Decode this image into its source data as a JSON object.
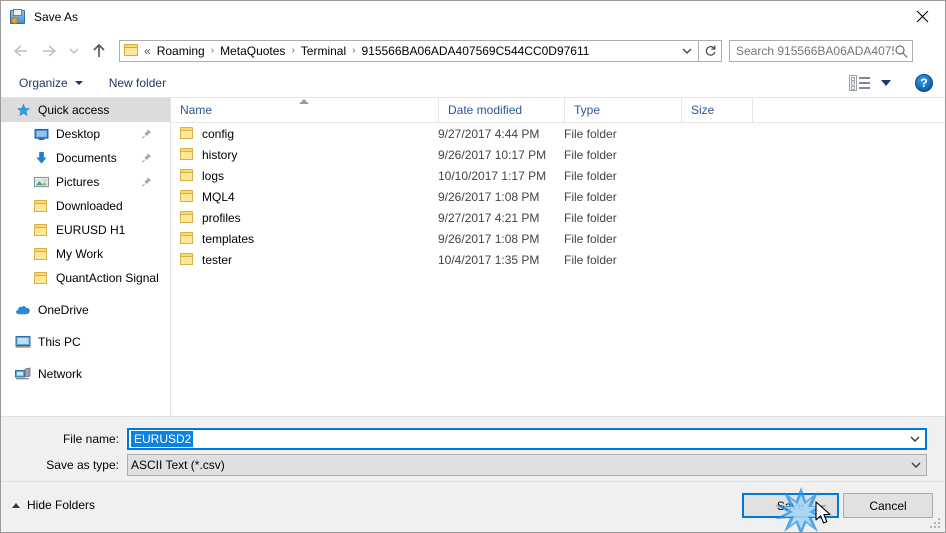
{
  "window": {
    "title": "Save As",
    "icon": "save-as-app-icon",
    "close_label": "✕"
  },
  "nav": {
    "back_label": "←",
    "forward_label": "→",
    "recent_label": "∨",
    "up_label": "↑",
    "overflow": "«",
    "breadcrumbs": [
      {
        "label": "Roaming"
      },
      {
        "label": "MetaQuotes"
      },
      {
        "label": "Terminal"
      },
      {
        "label": "915566BA06ADA407569C544CC0D97611"
      }
    ],
    "separator": "›",
    "dropdown_label": "∨",
    "refresh_label": "↻"
  },
  "search": {
    "placeholder": "Search 915566BA06ADA40756...",
    "icon": "search-icon"
  },
  "toolbar": {
    "organize_label": "Organize",
    "new_folder_label": "New folder",
    "view_icon": "view-layout-icon",
    "view_dropdown": "chevron-down-icon",
    "help_label": "?"
  },
  "sidebar": {
    "items": [
      {
        "label": "Quick access",
        "icon": "star-icon",
        "level": 0,
        "selected": true,
        "pinned": false
      },
      {
        "label": "Desktop",
        "icon": "monitor-icon",
        "level": 1,
        "selected": false,
        "pinned": true
      },
      {
        "label": "Documents",
        "icon": "download-arrow-icon",
        "level": 1,
        "selected": false,
        "pinned": true
      },
      {
        "label": "Pictures",
        "icon": "picture-icon",
        "level": 1,
        "selected": false,
        "pinned": true
      },
      {
        "label": "Downloaded",
        "icon": "folder-icon",
        "level": 1,
        "selected": false,
        "pinned": false
      },
      {
        "label": "EURUSD H1",
        "icon": "folder-icon",
        "level": 1,
        "selected": false,
        "pinned": false
      },
      {
        "label": "My Work",
        "icon": "folder-icon",
        "level": 1,
        "selected": false,
        "pinned": false
      },
      {
        "label": "QuantAction Signal",
        "icon": "folder-icon",
        "level": 1,
        "selected": false,
        "pinned": false
      },
      {
        "label": "OneDrive",
        "icon": "cloud-icon",
        "level": 0,
        "selected": false,
        "pinned": false
      },
      {
        "label": "This PC",
        "icon": "computer-icon",
        "level": 0,
        "selected": false,
        "pinned": false
      },
      {
        "label": "Network",
        "icon": "network-icon",
        "level": 0,
        "selected": false,
        "pinned": false
      }
    ]
  },
  "filelist": {
    "columns": [
      "Name",
      "Date modified",
      "Type",
      "Size"
    ],
    "sort_column": "Name",
    "sort_direction": "ascending",
    "rows": [
      {
        "name": "config",
        "date": "9/27/2017 4:44 PM",
        "type": "File folder",
        "size": ""
      },
      {
        "name": "history",
        "date": "9/26/2017 10:17 PM",
        "type": "File folder",
        "size": ""
      },
      {
        "name": "logs",
        "date": "10/10/2017 1:17 PM",
        "type": "File folder",
        "size": ""
      },
      {
        "name": "MQL4",
        "date": "9/26/2017 1:08 PM",
        "type": "File folder",
        "size": ""
      },
      {
        "name": "profiles",
        "date": "9/27/2017 4:21 PM",
        "type": "File folder",
        "size": ""
      },
      {
        "name": "templates",
        "date": "9/26/2017 1:08 PM",
        "type": "File folder",
        "size": ""
      },
      {
        "name": "tester",
        "date": "10/4/2017 1:35 PM",
        "type": "File folder",
        "size": ""
      }
    ]
  },
  "form": {
    "filename_label": "File name:",
    "filename_value": "EURUSD2",
    "filetype_label": "Save as type:",
    "filetype_value": "ASCII Text (*.csv)",
    "dropdown_icon": "chevron-down-icon"
  },
  "footer": {
    "hide_folders_label": "Hide Folders",
    "save_label": "Save",
    "cancel_label": "Cancel"
  },
  "colors": {
    "accent": "#0078d7",
    "selection": "#0b82e0",
    "header_text": "#2b579a",
    "toolbar_text": "#1f3864",
    "folder": "#ffd966",
    "form_bg": "#f0f0f0"
  }
}
